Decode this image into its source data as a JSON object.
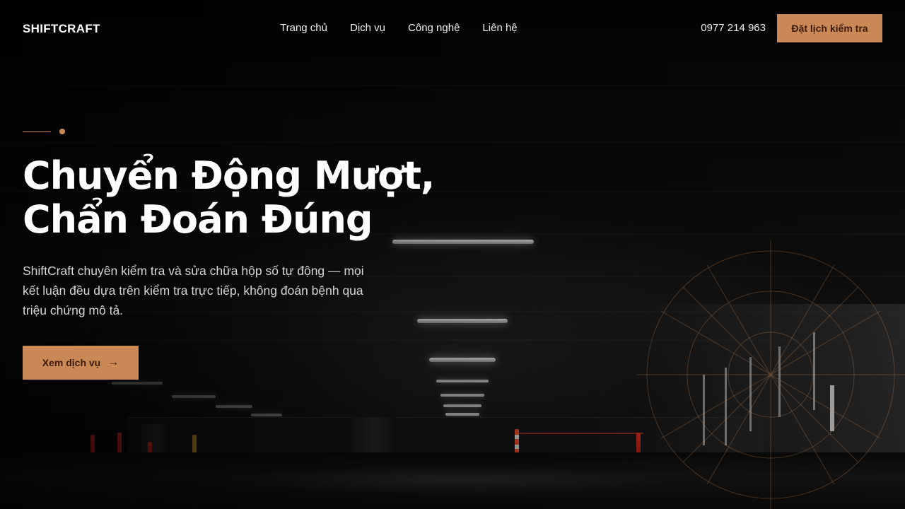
{
  "header": {
    "logo": "SHIFTCRAFT",
    "nav": [
      "Trang chủ",
      "Dịch vụ",
      "Công nghệ",
      "Liên hệ"
    ],
    "phone": "0977 214 963",
    "cta": "Đặt lịch kiểm tra"
  },
  "hero": {
    "title_line1": "Chuyển Động Mượt,",
    "title_line2": "Chẩn Đoán Đúng",
    "lead": "ShiftCraft chuyên kiểm tra và sửa chữa hộp số tự động — mọi kết luận đều dựa trên kiểm tra trực tiếp, không đoán bệnh qua triệu chứng mô tả.",
    "cta": "Xem dịch vụ",
    "cta_icon": "arrow-right-icon"
  },
  "colors": {
    "accent": "#c98856",
    "accent_text": "#3b1a05",
    "background": "#050505"
  }
}
